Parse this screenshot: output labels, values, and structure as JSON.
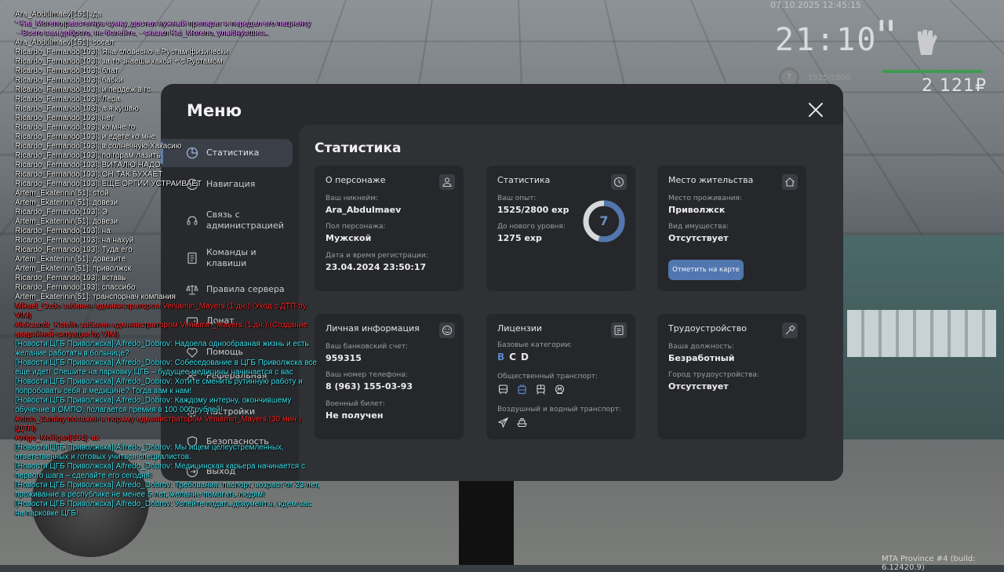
{
  "hud": {
    "datetime": "07.10.2025 12:45:15",
    "clock": "21:10",
    "level": "7",
    "exp": "1525/2800",
    "money": "2 121₽",
    "build": "MTA Province #4 (build: 6.12420.9)"
  },
  "chat": [
    {
      "text": "Ara_Abdulmaev[151]: да",
      "color": "white"
    },
    {
      "text": "* Kai_Moreno расстегнув сумку, достал нужный препарат и передал его пациенту",
      "color": "pink"
    },
    {
      "text": " - Всего вам доброго, не болейте, - сказал Kai_Moreno, улыбнувшись.",
      "color": "pink"
    },
    {
      "text": "Ara_Abdulmaev[151]: сосал",
      "color": "white"
    },
    {
      "text": "Ricardo_Fernando[193]: Яна словесно а Рустам физически",
      "color": "white"
    },
    {
      "text": "Ricardo_Fernando[193]: за то знаешь какой + с Рустамом",
      "color": "white"
    },
    {
      "text": "Ricardo_Fernando[193]: блат",
      "color": "white"
    },
    {
      "text": "Ricardo_Fernando[193]: бабки",
      "color": "white"
    },
    {
      "text": "Ricardo_Fernando[193]: и пердеж в гс",
      "color": "white"
    },
    {
      "text": "Ricardo_Fernando[193]: Лера",
      "color": "white"
    },
    {
      "text": "Ricardo_Fernando[193]: а я кушаю",
      "color": "white"
    },
    {
      "text": "Ricardo_Fernando[193]: нет",
      "color": "white"
    },
    {
      "text": "Ricardo_Fernando[193]: ко мне го",
      "color": "white"
    },
    {
      "text": "Ricardo_Fernando[193]: и едете ко мне",
      "color": "white"
    },
    {
      "text": "Ricardo_Fernando[193]: в солнечную Хакасию",
      "color": "white"
    },
    {
      "text": "Ricardo_Fernando[193]: по горам лазить",
      "color": "white"
    },
    {
      "text": "Ricardo_Fernando[193]: ВИТАЛЮ НАДО",
      "color": "white"
    },
    {
      "text": "Ricardo_Fernando[193]: ОН ТАК БУХАЕТ",
      "color": "white"
    },
    {
      "text": "Ricardo_Fernando[193]: ЕЩЕ ОРГИИ УСТРАИВАЕТ",
      "color": "white"
    },
    {
      "text": "Artem_Ekaterinin[51]: стой",
      "color": "white"
    },
    {
      "text": "Artem_Ekaterinin[51]: довези",
      "color": "white"
    },
    {
      "text": "Ricardo_Fernando[193]: Э",
      "color": "white"
    },
    {
      "text": "Artem_Ekaterinin[51]: довези",
      "color": "white"
    },
    {
      "text": "Ricardo_Fernando[193]: на",
      "color": "white"
    },
    {
      "text": "Ricardo_Fernando[193]: на нахуй",
      "color": "white"
    },
    {
      "text": "Ricardo_Fernando[193]: Туда его",
      "color": "white"
    },
    {
      "text": "Artem_Ekaterinin[51]: довезите",
      "color": "white"
    },
    {
      "text": "Artem_Ekaterinin[51]: приволжск",
      "color": "white"
    },
    {
      "text": "Ricardo_Fernando[193]: вставь",
      "color": "white"
    },
    {
      "text": "Ricardo_Fernando[193]: спассибо",
      "color": "white"
    },
    {
      "text": "Artem_Ekaterinin[51]: транспорнач компания",
      "color": "white"
    },
    {
      "text": "Mikael_Ozdo забанен администратором Veniamin_Mayers (1 дн.) (Уход с ДТП by VIM)",
      "color": "red"
    },
    {
      "text": "Aleksandr_Kotelin забанен администратором Veniamin_Mayers (1 дн.) (Создание аварийной ситуации by VIM)",
      "color": "red"
    },
    {
      "text": "[Новости ЦГБ Приволжска] Alfredo_Dobrov: Надоела однообразная жизнь и есть желание работать в больнице?",
      "color": "cyan"
    },
    {
      "text": "[Новости ЦГБ Приволжска] Alfredo_Dobrov: Собеседование в ЦГБ Приволжска все еще идет! Спешите на парковку ЦГБ – будущее медицины начинается с вас",
      "color": "cyan"
    },
    {
      "text": "[Новости ЦГБ Приволжска] Alfredo_Dobrov: Хотите сменить рутинную работу и попробовать себя в медицине? Тогда вам к нам!",
      "color": "cyan"
    },
    {
      "text": "[Новости ЦГБ Приволжска] Alfredo_Dobrov: Каждому интерну, окончившему обучение в ОМПО, полагается премия в 100 000 рублей!",
      "color": "cyan"
    },
    {
      "text": "Anton_Zaminy посажен в тюрьму администратором Veniamin_Mayers (30 мин.) (ДТП)",
      "color": "red"
    },
    {
      "text": "Arrigo_Molligan[151]: ах",
      "color": "red"
    },
    {
      "text": "[Новости ЦГБ Приволжска] Alfredo_Dobrov: Мы ищем целеустремленных, ответственных и готовых учиться специалистов.",
      "color": "cyan"
    },
    {
      "text": "[Новости ЦГБ Приволжска] Alfredo_Dobrov: Медицинская карьера начинается с первого шага – сделайте его сегодня!",
      "color": "cyan"
    },
    {
      "text": "[Новости ЦГБ Приволжска] Alfredo_Dobrov: Требования: паспорт, возраст от 23 лет, проживание в республике не менее 5 лет, желание помогать людям!",
      "color": "cyan"
    },
    {
      "text": "[Новости ЦГБ Приволжска] Alfredo_Dobrov: Успейте подать документы, ждем вас на парковке ЦГБ!",
      "color": "cyan"
    }
  ],
  "menu": {
    "title": "Меню",
    "nav": [
      {
        "label": "Статистика",
        "icon": "pie-chart-icon",
        "active": true
      },
      {
        "label": "Навигация",
        "icon": "compass-icon",
        "active": false
      },
      {
        "label": "Связь с администрацией",
        "icon": "headset-icon",
        "active": false
      },
      {
        "label": "Команды и клавиши",
        "icon": "document-icon",
        "active": false
      },
      {
        "label": "Правила сервера",
        "icon": "scales-icon",
        "active": false
      },
      {
        "label": "Донат",
        "icon": "wallet-icon",
        "active": false
      },
      {
        "label": "Помощь",
        "icon": "heart-icon",
        "active": false
      },
      {
        "label": "Реферальная",
        "icon": "users-icon",
        "active": false
      },
      {
        "label": "Настройки",
        "icon": "gear-icon",
        "active": false
      },
      {
        "label": "Безопасность",
        "icon": "shield-icon",
        "active": false
      },
      {
        "label": "Выход",
        "icon": "exit-icon",
        "active": false
      }
    ]
  },
  "content": {
    "title": "Статистика",
    "about": {
      "title": "О персонаже",
      "nickname_label": "Ваш никнейм:",
      "nickname": "Ara_Abdulmaev",
      "gender_label": "Пол персонажа:",
      "gender": "Мужской",
      "reg_label": "Дата и время регистрации:",
      "reg": "23.04.2024 23:50:17"
    },
    "stats": {
      "title": "Статистика",
      "exp_label": "Ваш опыт:",
      "exp": "1525/2800 exp",
      "next_label": "До нового уровня:",
      "next": "1275 exp",
      "level": "7",
      "progress": 0.545
    },
    "residence": {
      "title": "Место жительства",
      "place_label": "Место проживания:",
      "place": "Приволжск",
      "property_label": "Вид имущества:",
      "property": "Отсутствует",
      "button": "Отметить на карте"
    },
    "personal": {
      "title": "Личная информация",
      "bank_label": "Ваш банковский счет:",
      "bank": "959315",
      "phone_label": "Ваш номер телефона:",
      "phone": "8 (963) 155-03-93",
      "military_label": "Военный билет:",
      "military": "Не получен"
    },
    "licenses": {
      "title": "Лицензии",
      "base_label": "Базовые категории:",
      "cat_b": "B",
      "cat_c": "C",
      "cat_d": "D",
      "public_label": "Общественный транспорт:",
      "air_label": "Воздушный и водный транспорт:"
    },
    "employment": {
      "title": "Трудоустройство",
      "position_label": "Ваша должность:",
      "position": "Безработный",
      "city_label": "Город трудоустройства:",
      "city": "Отсутствует"
    }
  },
  "colors": {
    "accent": "#5176b0",
    "window_bg": "#27292c",
    "card_bg": "#25272a"
  }
}
